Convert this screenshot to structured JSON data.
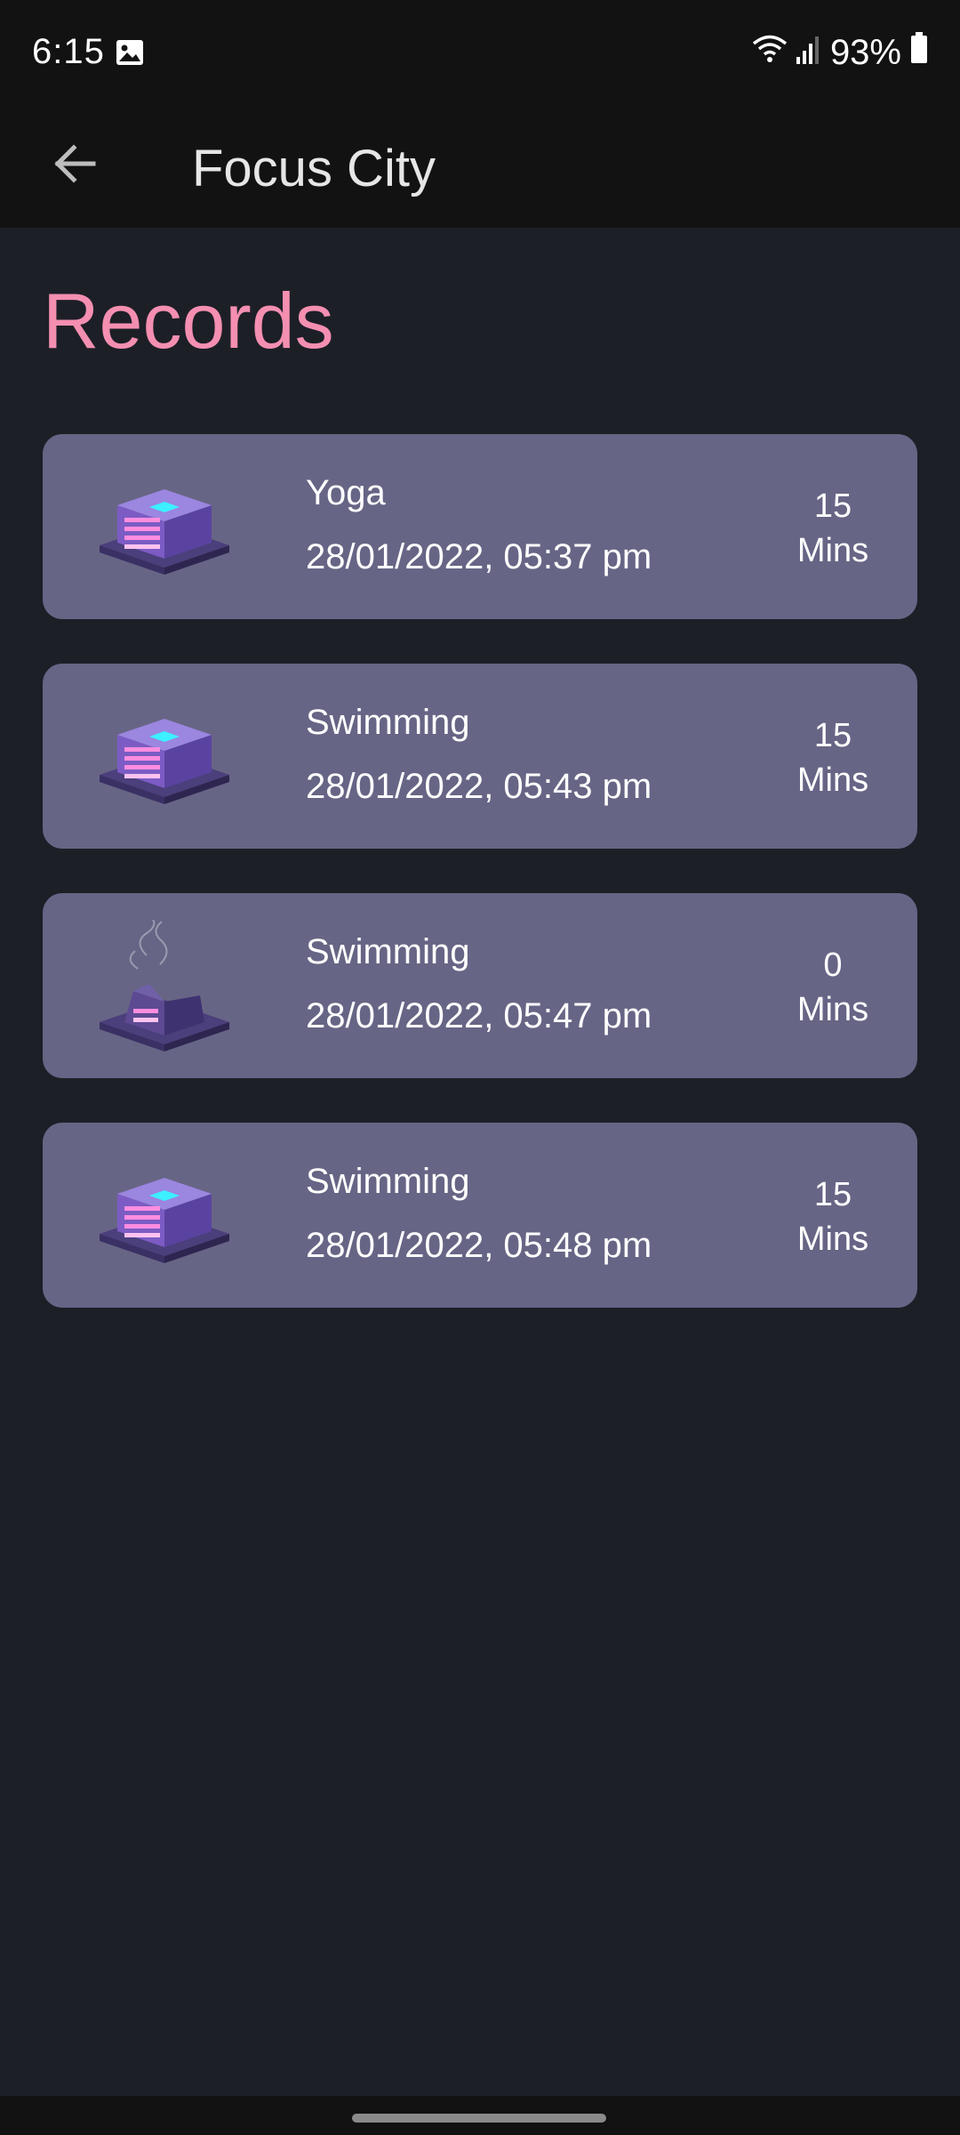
{
  "status_bar": {
    "time": "6:15",
    "battery": "93%",
    "icons": [
      "image-icon",
      "wifi-icon",
      "signal-icon",
      "battery-icon"
    ]
  },
  "app_bar": {
    "title": "Focus City",
    "back_icon": "arrow-left-icon"
  },
  "page": {
    "title": "Records",
    "title_color": "#f48fb1"
  },
  "records": [
    {
      "activity": "Yoga",
      "datetime": "28/01/2022, 05:37 pm",
      "duration_value": "15",
      "duration_unit": "Mins",
      "icon": "building-icon"
    },
    {
      "activity": "Swimming",
      "datetime": "28/01/2022, 05:43 pm",
      "duration_value": "15",
      "duration_unit": "Mins",
      "icon": "building-icon"
    },
    {
      "activity": "Swimming",
      "datetime": "28/01/2022, 05:47 pm",
      "duration_value": "0",
      "duration_unit": "Mins",
      "icon": "burnt-building-icon"
    },
    {
      "activity": "Swimming",
      "datetime": "28/01/2022, 05:48 pm",
      "duration_value": "15",
      "duration_unit": "Mins",
      "icon": "building-icon"
    }
  ],
  "colors": {
    "background": "#1d1f27",
    "card": "#676585",
    "bar": "#121212"
  }
}
